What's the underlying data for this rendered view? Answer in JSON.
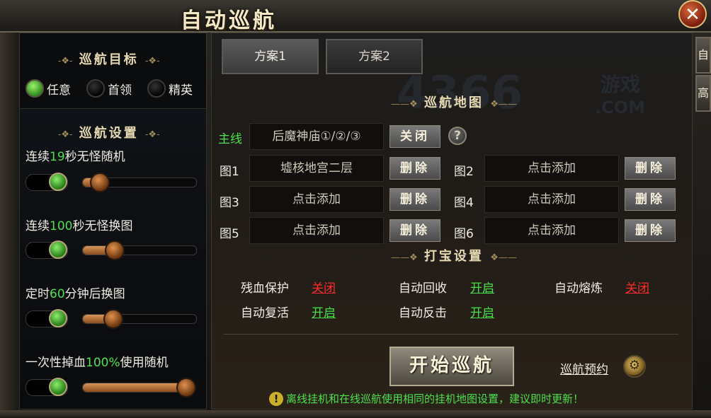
{
  "window": {
    "title": "自动巡航",
    "close_icon": "close-icon"
  },
  "target": {
    "header": "巡航目标",
    "options": [
      {
        "label": "任意",
        "selected": true
      },
      {
        "label": "首领",
        "selected": false
      },
      {
        "label": "精英",
        "selected": false
      }
    ]
  },
  "settings": {
    "header": "巡航设置",
    "items": [
      {
        "pre": "连续",
        "num": "19",
        "post": "秒无怪随机",
        "enabled": true,
        "level": 0.15
      },
      {
        "pre": "连续",
        "num": "100",
        "post": "秒无怪换图",
        "enabled": true,
        "level": 0.28
      },
      {
        "pre": "定时",
        "num": "60",
        "post": "分钟后换图",
        "enabled": true,
        "level": 0.27
      },
      {
        "pre": "一次性掉血",
        "num": "100%",
        "post": "使用随机",
        "enabled": true,
        "level": 1.0
      }
    ]
  },
  "tabs": [
    {
      "label": "方案1",
      "active": true
    },
    {
      "label": "方案2",
      "active": false
    }
  ],
  "side_tabs": [
    "自",
    "高"
  ],
  "watermark": {
    "main": "4366",
    "sub": "游戏",
    "domain": ".COM"
  },
  "map_section": {
    "header": "巡航地图",
    "main_label": "主线",
    "main_value": "后魔神庙①/②/③",
    "close_btn": "关闭",
    "help": "?",
    "maps": [
      {
        "label": "图1",
        "value": "墟核地宫二层",
        "btn": "删除"
      },
      {
        "label": "图2",
        "value": "点击添加",
        "btn": "删除"
      },
      {
        "label": "图3",
        "value": "点击添加",
        "btn": "删除"
      },
      {
        "label": "图4",
        "value": "点击添加",
        "btn": "删除"
      },
      {
        "label": "图5",
        "value": "点击添加",
        "btn": "删除"
      },
      {
        "label": "图6",
        "value": "点击添加",
        "btn": "删除"
      }
    ]
  },
  "loot_section": {
    "header": "打宝设置",
    "options": [
      {
        "label": "残血保护",
        "value": "关闭",
        "on": false
      },
      {
        "label": "自动回收",
        "value": "开启",
        "on": true
      },
      {
        "label": "自动熔炼",
        "value": "关闭",
        "on": false
      },
      {
        "label": "自动复活",
        "value": "开启",
        "on": true
      },
      {
        "label": "自动反击",
        "value": "开启",
        "on": true
      }
    ]
  },
  "start_button": "开始巡航",
  "reserve_label": "巡航预约",
  "notice": {
    "icon": "!",
    "text": "离线挂机和在线巡航使用相同的挂机地图设置，建议即时更新！"
  }
}
